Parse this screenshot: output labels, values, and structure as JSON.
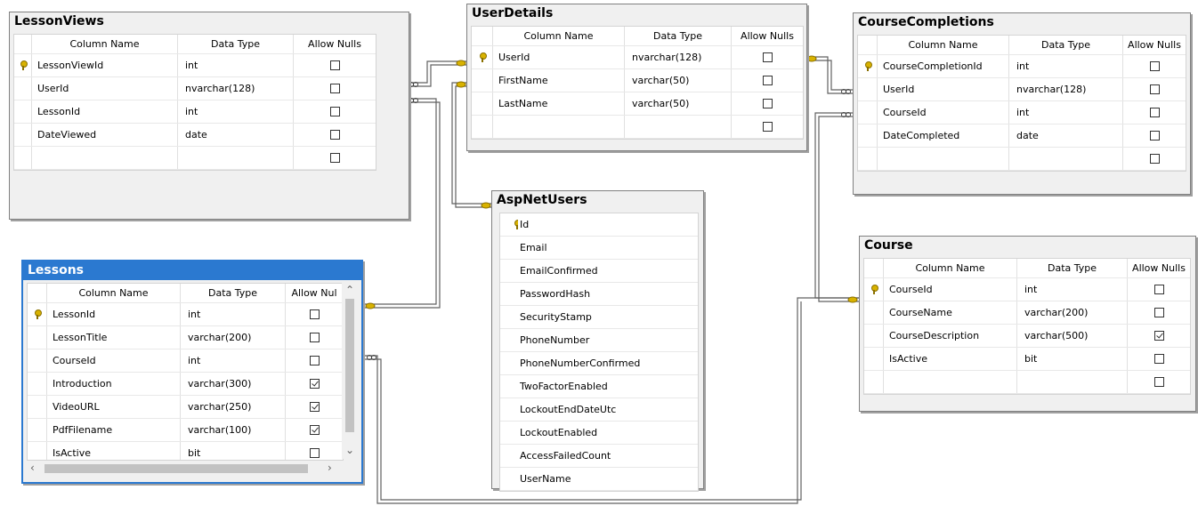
{
  "headers": {
    "key": "",
    "column_name": "Column Name",
    "data_type": "Data Type",
    "allow_nulls": "Allow Nulls",
    "allow_nulls_truncated": "Allow Nul"
  },
  "tables": {
    "lesson_views": {
      "title": "LessonViews",
      "rows": [
        {
          "pk": true,
          "name": "LessonViewId",
          "type": "int",
          "nulls": false
        },
        {
          "pk": false,
          "name": "UserId",
          "type": "nvarchar(128)",
          "nulls": false
        },
        {
          "pk": false,
          "name": "LessonId",
          "type": "int",
          "nulls": false
        },
        {
          "pk": false,
          "name": "DateViewed",
          "type": "date",
          "nulls": false
        },
        {
          "pk": false,
          "name": "",
          "type": "",
          "nulls": false
        }
      ]
    },
    "user_details": {
      "title": "UserDetails",
      "rows": [
        {
          "pk": true,
          "name": "UserId",
          "type": "nvarchar(128)",
          "nulls": false
        },
        {
          "pk": false,
          "name": "FirstName",
          "type": "varchar(50)",
          "nulls": false
        },
        {
          "pk": false,
          "name": "LastName",
          "type": "varchar(50)",
          "nulls": false
        },
        {
          "pk": false,
          "name": "",
          "type": "",
          "nulls": false
        }
      ]
    },
    "course_completions": {
      "title": "CourseCompletions",
      "rows": [
        {
          "pk": true,
          "name": "CourseCompletionId",
          "type": "int",
          "nulls": false
        },
        {
          "pk": false,
          "name": "UserId",
          "type": "nvarchar(128)",
          "nulls": false
        },
        {
          "pk": false,
          "name": "CourseId",
          "type": "int",
          "nulls": false
        },
        {
          "pk": false,
          "name": "DateCompleted",
          "type": "date",
          "nulls": false
        },
        {
          "pk": false,
          "name": "",
          "type": "",
          "nulls": false
        }
      ]
    },
    "asp_net_users": {
      "title": "AspNetUsers",
      "rows": [
        {
          "pk": true,
          "name": "Id"
        },
        {
          "pk": false,
          "name": "Email"
        },
        {
          "pk": false,
          "name": "EmailConfirmed"
        },
        {
          "pk": false,
          "name": "PasswordHash"
        },
        {
          "pk": false,
          "name": "SecurityStamp"
        },
        {
          "pk": false,
          "name": "PhoneNumber"
        },
        {
          "pk": false,
          "name": "PhoneNumberConfirmed"
        },
        {
          "pk": false,
          "name": "TwoFactorEnabled"
        },
        {
          "pk": false,
          "name": "LockoutEndDateUtc"
        },
        {
          "pk": false,
          "name": "LockoutEnabled"
        },
        {
          "pk": false,
          "name": "AccessFailedCount"
        },
        {
          "pk": false,
          "name": "UserName"
        }
      ]
    },
    "course": {
      "title": "Course",
      "rows": [
        {
          "pk": true,
          "name": "CourseId",
          "type": "int",
          "nulls": false
        },
        {
          "pk": false,
          "name": "CourseName",
          "type": "varchar(200)",
          "nulls": false
        },
        {
          "pk": false,
          "name": "CourseDescription",
          "type": "varchar(500)",
          "nulls": true
        },
        {
          "pk": false,
          "name": "IsActive",
          "type": "bit",
          "nulls": false
        },
        {
          "pk": false,
          "name": "",
          "type": "",
          "nulls": false
        }
      ]
    },
    "lessons": {
      "title": "Lessons",
      "rows": [
        {
          "pk": true,
          "name": "LessonId",
          "type": "int",
          "nulls": false
        },
        {
          "pk": false,
          "name": "LessonTitle",
          "type": "varchar(200)",
          "nulls": false
        },
        {
          "pk": false,
          "name": "CourseId",
          "type": "int",
          "nulls": false
        },
        {
          "pk": false,
          "name": "Introduction",
          "type": "varchar(300)",
          "nulls": true
        },
        {
          "pk": false,
          "name": "VideoURL",
          "type": "varchar(250)",
          "nulls": true
        },
        {
          "pk": false,
          "name": "PdfFilename",
          "type": "varchar(100)",
          "nulls": true
        },
        {
          "pk": false,
          "name": "IsActive",
          "type": "bit",
          "nulls": false
        }
      ]
    }
  },
  "icons": {
    "primary_key": "key-icon",
    "relationship_one": "key-end-icon",
    "relationship_many": "infinity-end-icon"
  },
  "colors": {
    "selected_title": "#2b79d0",
    "key": "#d8b200",
    "line": "#606060"
  }
}
